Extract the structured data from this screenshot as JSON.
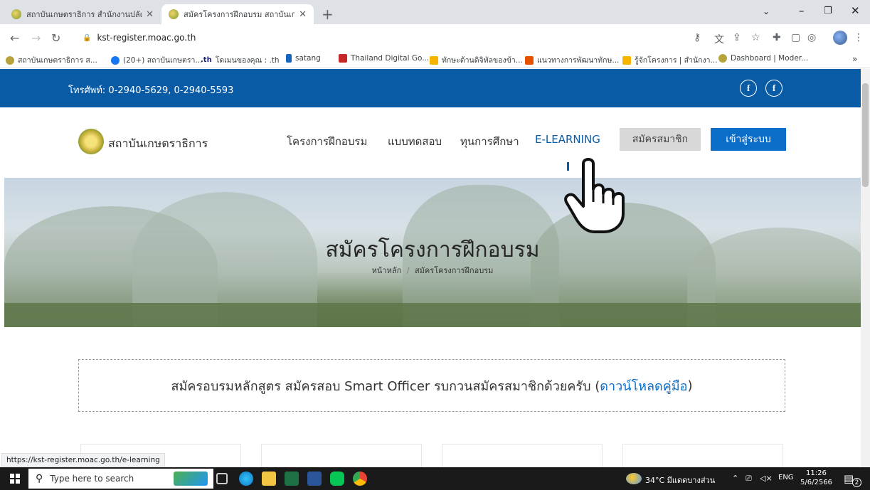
{
  "browser": {
    "tabs": [
      {
        "title": "สถาบันเกษตราธิการ สำนักงานปลัดกระ",
        "active": false
      },
      {
        "title": "สมัครโครงการฝึกอบรม สถาบันเกษตรา",
        "active": true
      }
    ],
    "url": "kst-register.moac.go.th",
    "bookmarks": [
      "สถาบันเกษตราธิการ ส...",
      "(20+) สถาบันเกษตรา...",
      "โดเมนของคุณ : .th",
      "satang",
      "Thailand Digital Go...",
      "ทักษะด้านดิจิทัลของข้า...",
      "แนวทางการพัฒนาทักษ...",
      "รู้จักโครงการ | สำนักงา...",
      "Dashboard | Moder..."
    ],
    "status_url": "https://kst-register.moac.go.th/e-learning"
  },
  "site": {
    "phone": "โทรศัพท์: 0-2940-5629, 0-2940-5593",
    "logo_text": "สถาบันเกษตราธิการ",
    "nav": [
      "โครงการฝึกอบรม",
      "แบบทดสอบ",
      "ทุนการศึกษา",
      "E-LEARNING"
    ],
    "register_btn": "สมัครสมาชิก",
    "login_btn": "เข้าสู่ระบบ",
    "hero_title": "สมัครโครงการฝึกอบรม",
    "breadcrumb_home": "หน้าหลัก",
    "breadcrumb_sep": "/",
    "breadcrumb_current": "สมัครโครงการฝึกอบรม",
    "notice_text": "สมัครอบรมหลักสูตร สมัครสอบ Smart Officer รบกวนสมัครสมาชิกด้วยครับ (",
    "notice_link": "ดาวน์โหลดคู่มือ",
    "notice_end": ")"
  },
  "taskbar": {
    "search_placeholder": "Type here to search",
    "weather": "34°C มีแดดบางส่วน",
    "lang": "ENG",
    "time": "11:26",
    "date": "5/6/2566",
    "notif_count": "2"
  },
  "colors": {
    "topbar": "#0a5ba6",
    "login_button": "#0a6dc8",
    "register_button": "#d8d8d8",
    "link": "#0a6dc8"
  }
}
